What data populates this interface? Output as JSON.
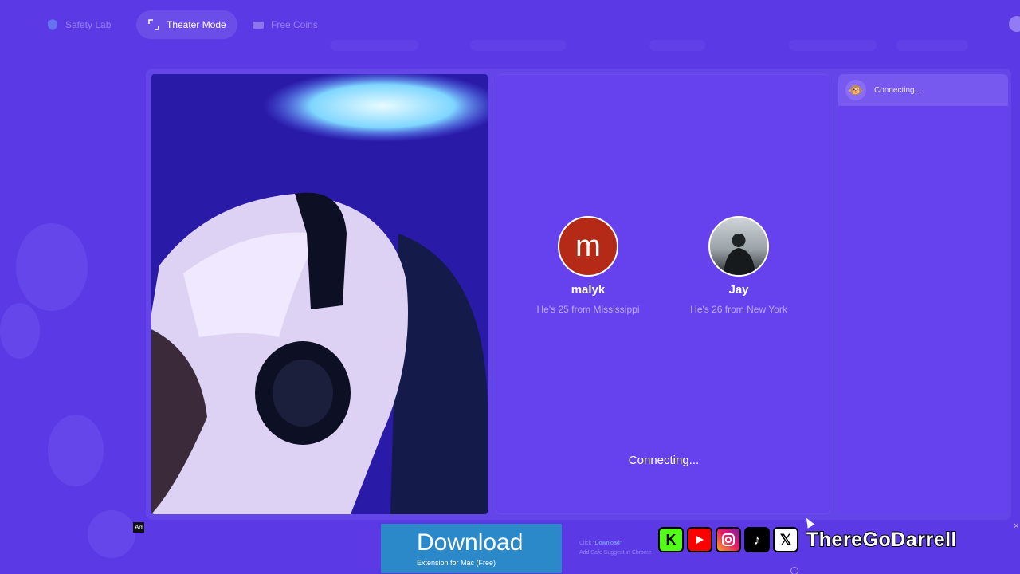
{
  "topbar": {
    "safety_lab": "Safety Lab",
    "theater_mode": "Theater Mode",
    "free_coins": "Free Coins"
  },
  "chat": {
    "status": "Connecting..."
  },
  "match": {
    "users": [
      {
        "initial": "m",
        "name": "malyk",
        "desc": "He's 25 from Mississippi",
        "avatar_color": "#b52a16"
      },
      {
        "name": "Jay",
        "desc": "He's 26 from New York"
      }
    ],
    "status": "Connecting..."
  },
  "ad": {
    "badge": "Ad",
    "download_title": "Download",
    "download_sub": "Extension for Mac (Free)",
    "hint_prefix": "Click ",
    "hint_link": "\"Download\"",
    "hint_line2": "Add Safe Suggest in Chrome"
  },
  "overlay": {
    "handle": "ThereGoDarrell",
    "icons": [
      "kick-icon",
      "youtube-icon",
      "instagram-icon",
      "tiktok-icon",
      "x-icon"
    ]
  },
  "colors": {
    "background": "#5b3ae6",
    "panel": "#6542ee",
    "download_button": "#2b89c9",
    "kick": "#53fc18",
    "youtube": "#ff0000"
  }
}
